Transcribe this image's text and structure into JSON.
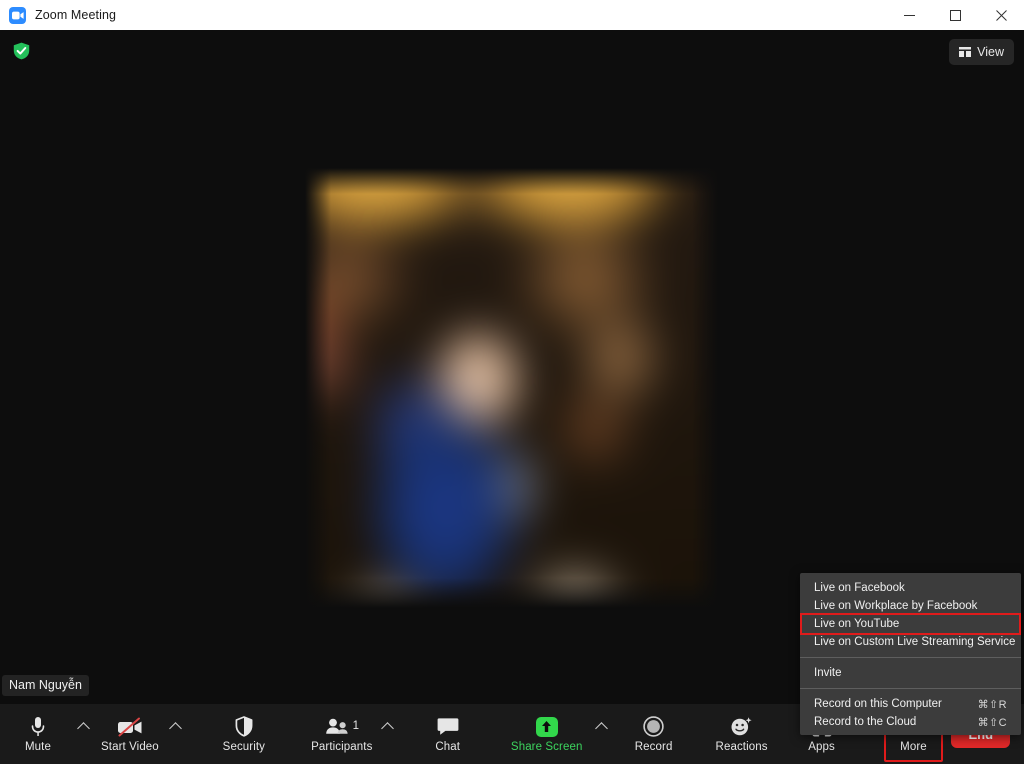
{
  "window": {
    "title": "Zoom Meeting",
    "logo_icon": "zoom-camera-icon",
    "minimize_icon": "minimize-icon",
    "maximize_icon": "maximize-icon",
    "close_icon": "close-icon"
  },
  "stage": {
    "encryption_icon": "green-shield-check-icon",
    "view_button": {
      "label": "View",
      "icon": "grid-view-icon"
    },
    "participant_name": "Nam Nguyễn"
  },
  "toolbar": {
    "items": [
      {
        "label": "Mute",
        "icon": "microphone-icon",
        "has_chevron": true,
        "name": "mute"
      },
      {
        "label": "Start Video",
        "icon": "camera-off-icon",
        "has_chevron": true,
        "name": "start-video"
      },
      {
        "label": "Security",
        "icon": "shield-icon",
        "has_chevron": false,
        "name": "security"
      },
      {
        "label": "Participants",
        "icon": "participants-icon",
        "badge": "1",
        "has_chevron": true,
        "name": "participants"
      },
      {
        "label": "Chat",
        "icon": "chat-bubble-icon",
        "has_chevron": false,
        "name": "chat"
      },
      {
        "label": "Share Screen",
        "icon": "share-screen-up-arrow-icon",
        "has_chevron": true,
        "name": "share-screen",
        "accent": true
      },
      {
        "label": "Record",
        "icon": "record-circle-icon",
        "has_chevron": false,
        "name": "record"
      },
      {
        "label": "Reactions",
        "icon": "smiley-sparkle-icon",
        "has_chevron": false,
        "name": "reactions"
      },
      {
        "label": "Apps",
        "icon": "apps-bracket-icon",
        "has_chevron": false,
        "name": "apps"
      },
      {
        "label": "More",
        "icon": "ellipsis-icon",
        "has_chevron": false,
        "name": "more",
        "highlighted": true
      }
    ],
    "end_button": "End"
  },
  "more_menu": {
    "groups": [
      {
        "items": [
          {
            "label": "Live on Facebook",
            "shortcut": "",
            "highlighted": false
          },
          {
            "label": "Live on Workplace by Facebook",
            "shortcut": "",
            "highlighted": false
          },
          {
            "label": "Live on YouTube",
            "shortcut": "",
            "highlighted": true
          },
          {
            "label": "Live on Custom Live Streaming Service",
            "shortcut": "",
            "highlighted": false
          }
        ]
      },
      {
        "items": [
          {
            "label": "Invite",
            "shortcut": "",
            "highlighted": false
          }
        ]
      },
      {
        "items": [
          {
            "label": "Record on this Computer",
            "shortcut": "⌘⇧R",
            "highlighted": false
          },
          {
            "label": "Record to the Cloud",
            "shortcut": "⌘⇧C",
            "highlighted": false
          }
        ]
      }
    ]
  },
  "colors": {
    "accent_green": "#32d74b",
    "danger_red": "#e02828",
    "highlight_red": "#e01b1b",
    "titlebar_bg": "#ffffff",
    "toolbar_bg": "#1a1a1a",
    "menu_bg": "#3c3c3c",
    "zoom_blue": "#2d8cff"
  }
}
